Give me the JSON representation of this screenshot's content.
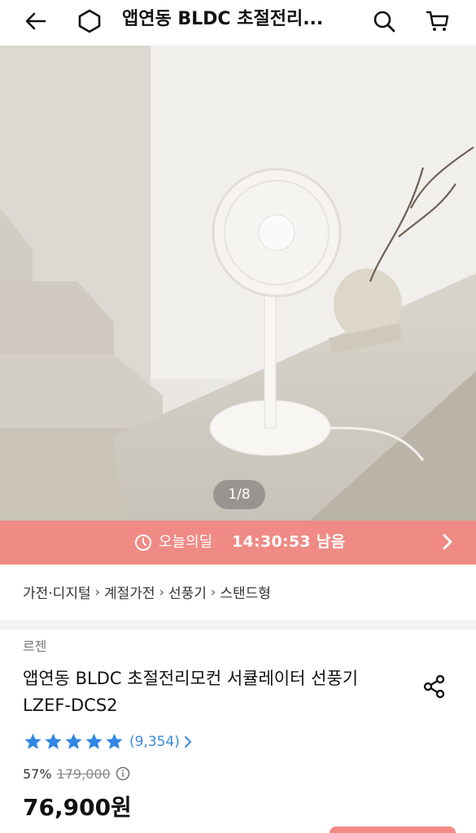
{
  "header": {
    "title": "앱연동 BLDC 초절전리...",
    "icons": [
      "back-arrow-icon",
      "home-icon",
      "search-icon",
      "cart-icon"
    ]
  },
  "hero": {
    "page_indicator": "1/8"
  },
  "deal": {
    "label": "오늘의딜",
    "time": "14:30:53 남음",
    "color": "#f08a84"
  },
  "breadcrumb": {
    "items": [
      "가전·디지털",
      "계절가전",
      "선풍기",
      "스탠드형"
    ]
  },
  "product": {
    "brand": "르젠",
    "title": "앱연동 BLDC 초절전리모컨 서큘레이터 선풍기 LZEF-DCS2",
    "rating_stars": 5,
    "review_count": "(9,354)",
    "discount": "57%",
    "original_price": "179,000",
    "final_price": "76,900원"
  },
  "colors": {
    "accent": "#f08a84",
    "star": "#2f86e4",
    "link": "#3a8be0"
  }
}
